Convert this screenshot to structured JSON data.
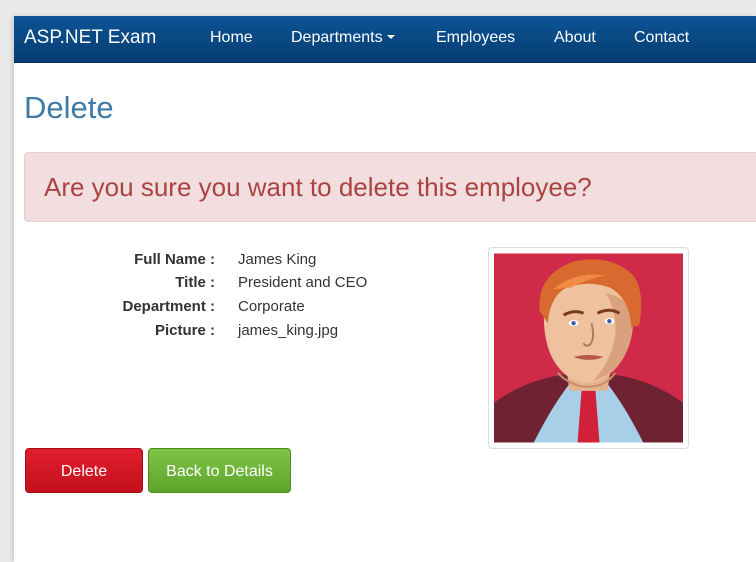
{
  "navbar": {
    "brand": "ASP.NET Exam",
    "items": [
      {
        "label": "Home"
      },
      {
        "label": "Departments"
      },
      {
        "label": "Employees"
      },
      {
        "label": "About"
      },
      {
        "label": "Contact"
      }
    ]
  },
  "page": {
    "title": "Delete",
    "alert": "Are you sure you want to delete this employee?"
  },
  "details": {
    "full_name_label": "Full Name :",
    "full_name": "James King",
    "title_label": "Title :",
    "title": "President and CEO",
    "department_label": "Department :",
    "department": "Corporate",
    "picture_label": "Picture :",
    "picture": "james_king.jpg"
  },
  "actions": {
    "delete_label": "Delete",
    "back_label": "Back to Details"
  },
  "colors": {
    "navbar": "#063d73",
    "title": "#3f7ba6",
    "alert_background": "#f2dede",
    "alert_text": "#a94442",
    "delete_button": "#d41726",
    "back_button": "#6eb43a"
  }
}
